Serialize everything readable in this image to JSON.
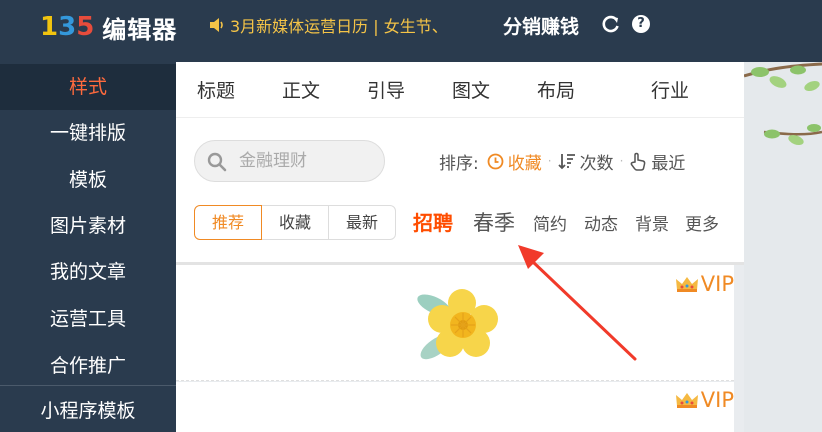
{
  "header": {
    "logo_digits": [
      "1",
      "3",
      "5"
    ],
    "logo_text": "编辑器",
    "notice": "3月新媒体运营日历 | 女生节、",
    "earn_label": "分销赚钱",
    "help_label": "?"
  },
  "sidebar": {
    "items": [
      {
        "label": "样式",
        "active": true
      },
      {
        "label": "一键排版"
      },
      {
        "label": "模板"
      },
      {
        "label": "图片素材"
      },
      {
        "label": "我的文章"
      },
      {
        "label": "运营工具"
      },
      {
        "label": "合作推广"
      },
      {
        "label": "小程序模板"
      }
    ]
  },
  "panel": {
    "tabs": [
      "标题",
      "正文",
      "引导",
      "图文",
      "布局",
      "行业"
    ],
    "search": {
      "placeholder": "金融理财"
    },
    "sort": {
      "label": "排序:",
      "options": [
        {
          "label": "收藏",
          "icon": "clock-icon",
          "active": true
        },
        {
          "label": "次数",
          "icon": "sort-desc-icon"
        },
        {
          "label": "最近",
          "icon": "pointer-hand-icon"
        }
      ]
    },
    "filters": [
      "推荐",
      "收藏",
      "最新"
    ],
    "categories": [
      "招聘",
      "春季",
      "简约",
      "动态",
      "背景",
      "更多"
    ]
  },
  "cards": [
    {
      "badge": "VIP",
      "icon": "flower-illustration"
    },
    {
      "badge": "VIP"
    }
  ],
  "colors": {
    "nav_bg": "#2a3b4e",
    "accent_orange": "#f08a24",
    "hot_red": "#ff4d00",
    "notice_yellow": "#f5c447"
  }
}
